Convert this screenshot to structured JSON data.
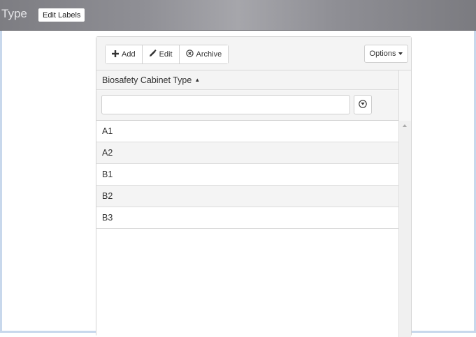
{
  "header": {
    "title": "Type",
    "edit_labels_button": "Edit Labels"
  },
  "toolbar": {
    "add_label": "Add",
    "edit_label": "Edit",
    "archive_label": "Archive",
    "options_label": "Options"
  },
  "grid": {
    "column_header": "Biosafety Cabinet Type",
    "sort_direction": "ascending",
    "filter": {
      "value": "",
      "placeholder": ""
    },
    "rows": [
      "A1",
      "A2",
      "B1",
      "B2",
      "B3"
    ]
  },
  "icons": {
    "add": "plus-icon",
    "edit": "pencil-icon",
    "archive": "circle-x-icon",
    "filter": "filter-icon",
    "sort": "sort-asc-icon",
    "scroll_up": "scroll-up-icon"
  },
  "colors": {
    "header_bg": "#8f8f95",
    "frame_border": "#c8d8ec",
    "row_alt": "#f4f4f4"
  }
}
